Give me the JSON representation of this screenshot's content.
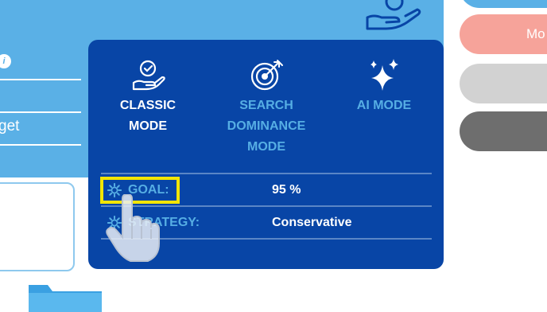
{
  "left_panel": {
    "info_badge": "i",
    "budget_label": "get"
  },
  "modes": [
    {
      "label": "CLASSIC\nMODE",
      "icon": "hand-check-icon",
      "active": true
    },
    {
      "label": "SEARCH\nDOMINANCE\nMODE",
      "icon": "target-icon",
      "active": false
    },
    {
      "label": "AI MODE",
      "icon": "sparkle-icon",
      "active": false
    }
  ],
  "settings": {
    "goal": {
      "label": "GOAL:",
      "value": "95 %"
    },
    "strategy": {
      "label": "STRATEGY:",
      "value": "Conservative"
    }
  },
  "right_buttons": {
    "salmon_label": "Mo"
  },
  "colors": {
    "panel_light_blue": "#5ab0e6",
    "card_dark_blue": "#0845a6",
    "label_blue": "#56aee4",
    "highlight_yellow": "#f3e500",
    "salmon": "#f6a39a",
    "light_gray": "#d2d2d2",
    "dark_gray": "#6e6e6e"
  }
}
